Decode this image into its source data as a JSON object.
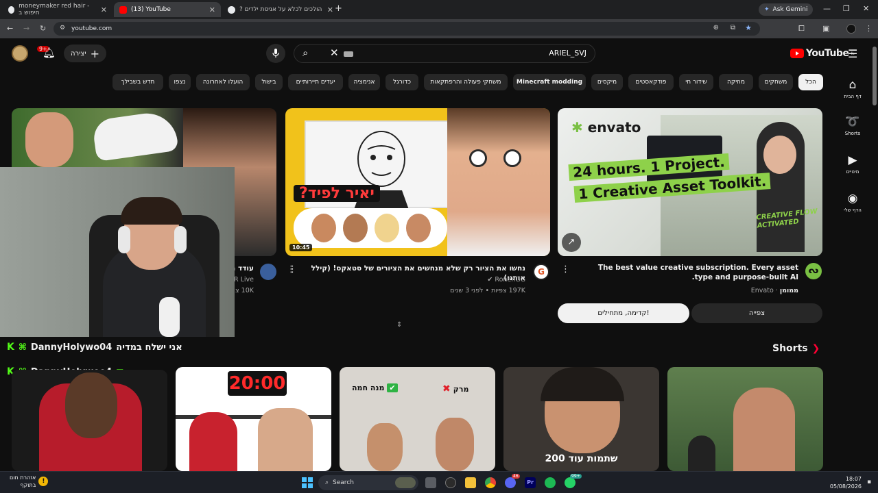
{
  "browser": {
    "tabs": [
      {
        "title": "moneymaker red hair - חיפוש ב"
      },
      {
        "title": "(13) YouTube"
      },
      {
        "title": "הולכים לכלא על אניסת ילדים ?"
      }
    ],
    "new_tab": "+",
    "gemini_label": "Ask Gemini",
    "url": "youtube.com"
  },
  "masthead": {
    "create_label": "יצירה",
    "notification_count": "9+",
    "search_query": "ARIEL_SVJ",
    "logo_text": "YouTube",
    "logo_region": "IL"
  },
  "chips": [
    {
      "label": "הכל",
      "active": true
    },
    {
      "label": "משחקים"
    },
    {
      "label": "מוזיקה"
    },
    {
      "label": "שידור חי"
    },
    {
      "label": "פודקאסטים"
    },
    {
      "label": "מיקסים"
    },
    {
      "label": "Minecraft modding"
    },
    {
      "label": "משחקי פעולה והרפתקאות"
    },
    {
      "label": "כדורגל"
    },
    {
      "label": "אנימציה"
    },
    {
      "label": "יעדים תיירותיים"
    },
    {
      "label": "בישול"
    },
    {
      "label": "הועלו לאחרונה"
    },
    {
      "label": "נצפו"
    },
    {
      "label": "חדש בשבילך"
    }
  ],
  "guide": [
    {
      "label": "דף הבית",
      "icon": "home-icon"
    },
    {
      "label": "Shorts",
      "icon": "shorts-icon"
    },
    {
      "label": "מינויים",
      "icon": "subscriptions-icon"
    },
    {
      "label": "הדף שלי",
      "icon": "profile-icon"
    }
  ],
  "videos": [
    {
      "title": "The best value creative subscription. Every asset type and purpose-built AI.",
      "channel": "Envato",
      "sponsored": "ממומן",
      "thumb_text_1": "envato",
      "thumb_text_2": "24 hours. 1 Project.",
      "thumb_text_3": "1 Creative Asset Toolkit.",
      "thumb_text_4": "CREATIVE FLOW ACTIVATED",
      "btn_watch": "צפייה",
      "btn_go": "קדימה, מתחילים!"
    },
    {
      "title": "נחשו את הציור רק שלא מנחשים את הציורים של סטאקס! (קילל אותנו)",
      "channel": "RonenGG",
      "meta": "197K צפיות • לפני 3 שנים",
      "duration": "10:45",
      "thumb_text": "יאיר לפיד?"
    },
    {
      "title": "עודד מ",
      "channel": "R Live",
      "meta": "10K צ"
    }
  ],
  "overlay_chat": [
    {
      "badge": "K",
      "user": "DannyHolywo04",
      "message": "אני ישלח במדיה"
    },
    {
      "badge": "K",
      "user": "DannyHolywoo4",
      "message": ""
    }
  ],
  "shorts": {
    "title": "Shorts",
    "items": [
      {
        "caption": "שתמות עוד 200"
      },
      {
        "caption_right": "מרק",
        "caption_left": "מנה חמה"
      },
      {
        "caption": "20:00"
      },
      {
        "caption": ""
      },
      {
        "caption": ""
      }
    ]
  },
  "taskbar": {
    "search_label": "Search",
    "weather_line1": "אזהרת חום",
    "weather_line2": "בתוקף",
    "time": "18:07",
    "date": "05/08/2026",
    "discord_badge": "46",
    "whatsapp_badge": "99+"
  },
  "colors": {
    "yt_red": "#ff0000",
    "page_bg": "#0f0f0f",
    "chip_bg": "#272727",
    "envato_green": "#7ac043",
    "kick_green": "#53fc18"
  }
}
